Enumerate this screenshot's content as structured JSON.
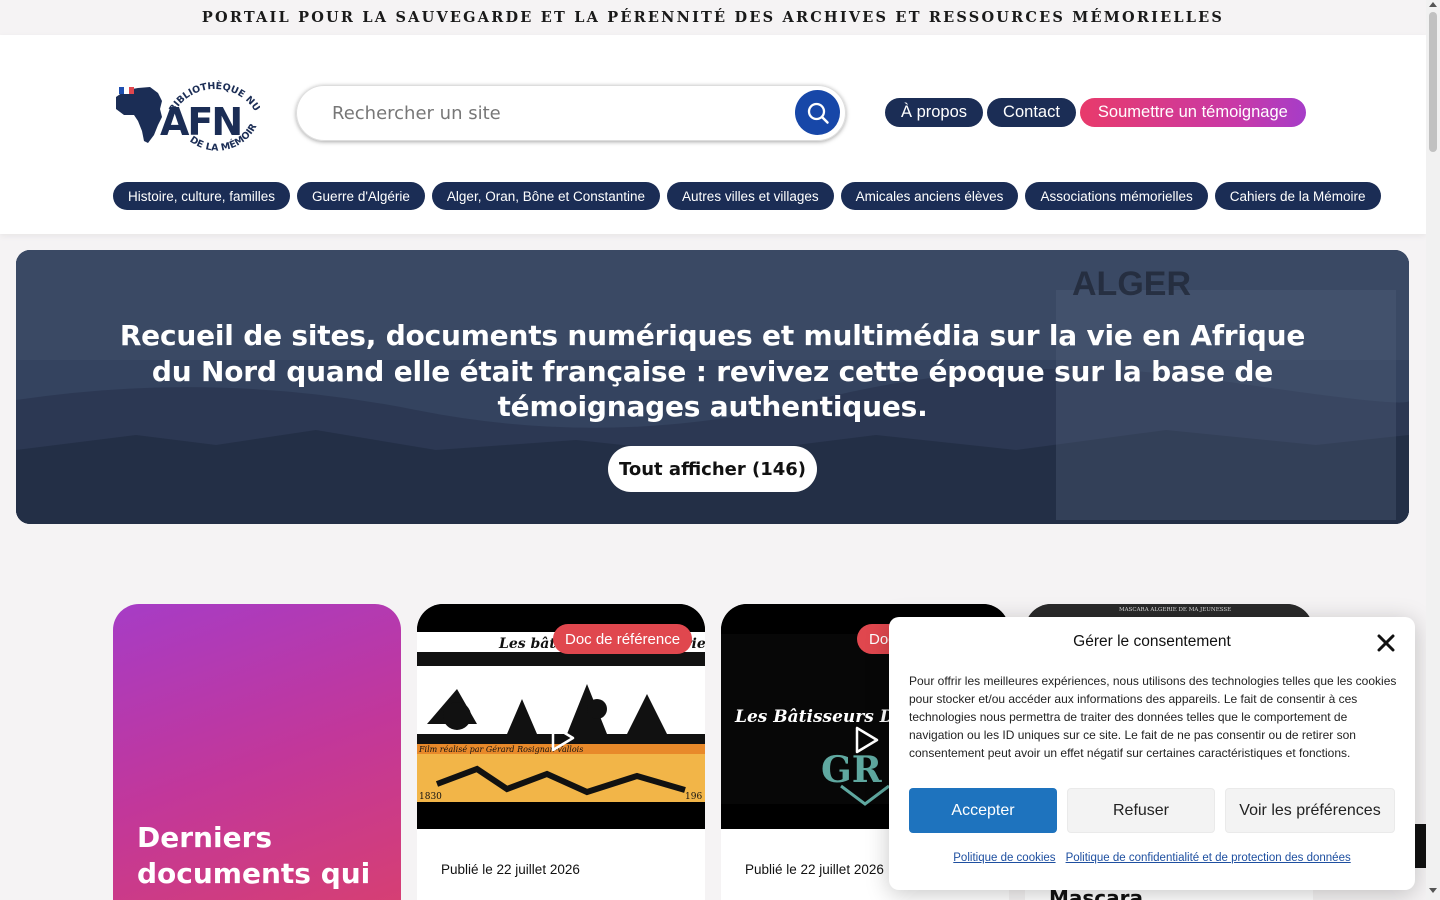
{
  "topbar": {
    "tagline": "PORTAIL POUR LA SAUVEGARDE ET LA PÉRENNITÉ DES ARCHIVES ET RESSOURCES MÉMORIELLES"
  },
  "logo": {
    "ring_text_top": "BIBLIOTHÈQUE NUMÉRIQUE",
    "ring_text_bottom": "DE LA MÉMOIRE",
    "mark": "AFN"
  },
  "search": {
    "placeholder": "Rechercher un site",
    "icon": "search-icon"
  },
  "header_buttons": {
    "about": "À propos",
    "contact": "Contact",
    "submit": "Soumettre un témoignage"
  },
  "nav": {
    "items": [
      "Histoire, culture, familles",
      "Guerre d'Algérie",
      "Alger, Oran, Bône et Constantine",
      "Autres villes et villages",
      "Amicales anciens élèves",
      "Associations mémorielles",
      "Cahiers de la Mémoire"
    ]
  },
  "hero": {
    "photo_caption": "ALGER",
    "title": "Recueil de sites, documents numériques et multimédia sur la vie en Afrique du Nord quand elle était française : revivez cette époque sur la base de témoignages authentiques.",
    "button": "Tout afficher (146)"
  },
  "cards": {
    "feature_title": "Derniers documents qui",
    "card1": {
      "badge": "Doc de référence",
      "image_title": "Les bâtisseurs de l'Algérie coloniale",
      "image_credit": "Film réalisé par Gérard Rosignan-Vallois",
      "year_start": "1830",
      "year_end": "196",
      "date": "Publié le 22 juillet 2026"
    },
    "card2": {
      "badge": "Doc",
      "image_title": "Les Bâtisseurs De",
      "date": "Publié le 22 juillet 2026"
    },
    "card3": {
      "image_header": "MASCARA ALGERIE DE MA JEUNESSE",
      "title": "Mascara"
    }
  },
  "consent": {
    "title": "Gérer le consentement",
    "body": "Pour offrir les meilleures expériences, nous utilisons des technologies telles que les cookies pour stocker et/ou accéder aux informations des appareils. Le fait de consentir à ces technologies nous permettra de traiter des données telles que le comportement de navigation ou les ID uniques sur ce site. Le fait de ne pas consentir ou de retirer son consentement peut avoir un effet négatif sur certaines caractéristiques et fonctions.",
    "accept": "Accepter",
    "refuse": "Refuser",
    "preferences": "Voir les préférences",
    "link_cookies": "Politique de cookies",
    "link_privacy": "Politique de confidentialité et de protection des données"
  },
  "colors": {
    "navy": "#1b2d55",
    "search_blue": "#1747a8",
    "accept_blue": "#1e73be",
    "badge_red": "#e0474e",
    "gradient_pink": "#e83a6b",
    "gradient_purple": "#a63dc8"
  }
}
